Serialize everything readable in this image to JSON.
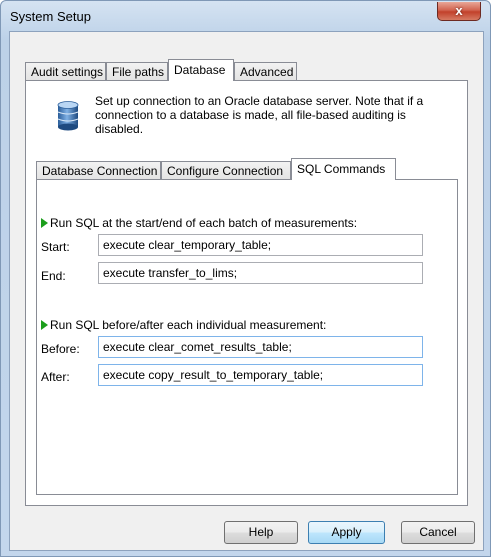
{
  "window": {
    "title": "System Setup",
    "close_glyph": "x"
  },
  "tabs": [
    "Audit settings",
    "File paths",
    "Database",
    "Advanced"
  ],
  "info": {
    "icon": "database-icon",
    "text": "Set up connection to an Oracle database server. Note that if a connection to a database is made, all file-based auditing is disabled."
  },
  "subtabs": [
    "Database Connection",
    "Configure Connection",
    "SQL Commands"
  ],
  "batch": {
    "heading": "Run SQL at the start/end of each batch of measurements:",
    "start_label": "Start:",
    "start_value": "execute clear_temporary_table;",
    "end_label": "End:",
    "end_value": "execute transfer_to_lims;"
  },
  "measurement": {
    "heading": "Run SQL before/after each individual measurement:",
    "before_label": "Before:",
    "before_value": "execute clear_comet_results_table;",
    "after_label": "After:",
    "after_value": "execute copy_result_to_temporary_table;"
  },
  "buttons": {
    "help": "Help",
    "apply": "Apply",
    "cancel": "Cancel"
  },
  "colors": {
    "arrow": "#1c9e1c",
    "close": "#c2412b"
  }
}
